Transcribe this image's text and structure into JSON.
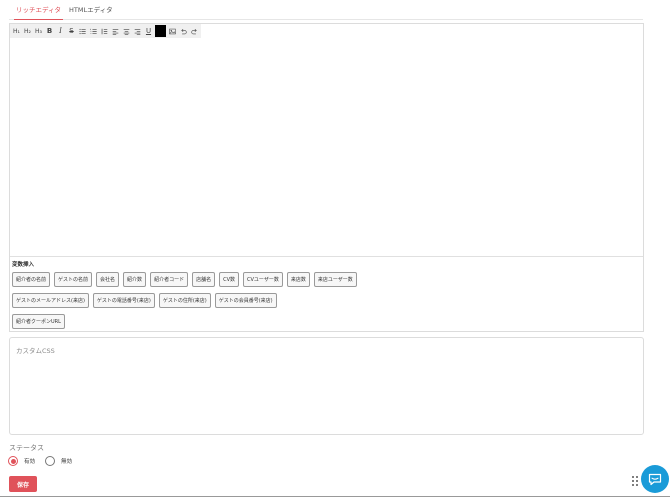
{
  "tabs": [
    {
      "label": "リッチエディタ",
      "active": true
    },
    {
      "label": "HTMLエディタ",
      "active": false
    }
  ],
  "toolbar": {
    "items": [
      {
        "name": "heading-h1",
        "label": "H₁"
      },
      {
        "name": "heading-h2",
        "label": "H₂"
      },
      {
        "name": "heading-h3",
        "label": "H₃"
      },
      {
        "name": "bold",
        "label": "B"
      },
      {
        "name": "italic",
        "label": "I"
      },
      {
        "name": "strikethrough",
        "label": "S"
      },
      {
        "name": "bullet-list",
        "label": ""
      },
      {
        "name": "ordered-list",
        "label": ""
      },
      {
        "name": "blockquote",
        "label": ""
      },
      {
        "name": "align-left",
        "label": ""
      },
      {
        "name": "align-center",
        "label": ""
      },
      {
        "name": "align-right",
        "label": ""
      },
      {
        "name": "underline",
        "label": "U"
      },
      {
        "name": "text-color",
        "label": ""
      },
      {
        "name": "image",
        "label": ""
      },
      {
        "name": "undo",
        "label": ""
      },
      {
        "name": "redo",
        "label": ""
      }
    ],
    "text_color": "#000000"
  },
  "variables": {
    "title": "変数挿入",
    "row1": [
      "紹介者の名前",
      "ゲストの名前",
      "会社名",
      "紹介数",
      "紹介者コード",
      "店舗名",
      "CV数",
      "CVユーザー数",
      "来店数",
      "来店ユーザー数"
    ],
    "row2": [
      "ゲストのメールアドレス(来店)",
      "ゲストの電話番号(来店)",
      "ゲストの住所(来店)",
      "ゲストの会員番号(来店)"
    ],
    "row3": [
      "紹介者クーポンURL"
    ]
  },
  "custom_css": {
    "placeholder": "カスタムCSS",
    "value": ""
  },
  "status": {
    "label": "ステータス",
    "options": [
      {
        "label": "有効",
        "checked": true
      },
      {
        "label": "無効",
        "checked": false
      }
    ]
  },
  "save_label": "保存",
  "colors": {
    "accent": "#e0525a",
    "chat": "#1a9bd8"
  }
}
